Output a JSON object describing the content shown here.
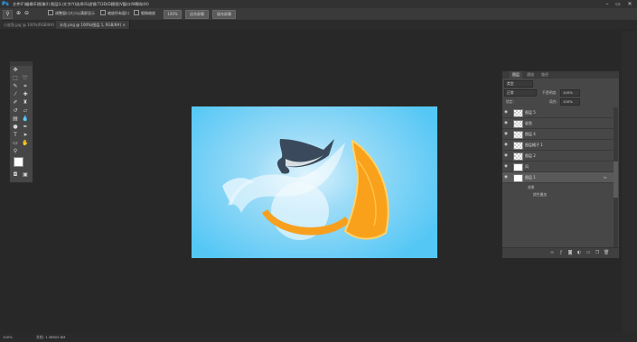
{
  "app": {
    "logo": "Ps"
  },
  "menu": [
    "文件(F)",
    "编辑(E)",
    "图像(I)",
    "图层(L)",
    "文字(Y)",
    "选择(S)",
    "滤镜(T)",
    "3D(D)",
    "视图(V)",
    "窗口(W)",
    "帮助(H)"
  ],
  "window_controls": [
    "–",
    "▭",
    "✕"
  ],
  "options": {
    "resize_windows": "调整窗口大小以满屏显示",
    "zoom_all": "缩放所有窗口",
    "scrubby_zoom": "细微缩放",
    "btn_100": "100%",
    "btn_fit": "适合屏幕",
    "btn_fill": "填充屏幕"
  },
  "tabs": [
    {
      "label": "小鲨鱼.jpg @ 100%(RGB/8#) ×",
      "active": false
    },
    {
      "label": "水花.png @ 100%(图层 1, RGB/8#) ×",
      "active": true
    }
  ],
  "layers_panel": {
    "tabs": [
      "图层",
      "通道",
      "路径"
    ],
    "kind_filter": "类型",
    "blend_mode": "正常",
    "opacity_label": "不透明度:",
    "opacity_value": "100%",
    "lock_label": "锁定:",
    "fill_label": "填充:",
    "fill_value": "100%",
    "layers": [
      {
        "name": "图层 5",
        "thumb": "checker",
        "selected": false
      },
      {
        "name": "鲨鱼",
        "thumb": "checker",
        "selected": false
      },
      {
        "name": "图层 4",
        "thumb": "checker",
        "selected": false
      },
      {
        "name": "图层橘子 1",
        "thumb": "checker",
        "selected": false
      },
      {
        "name": "图层 2",
        "thumb": "checker",
        "selected": false
      },
      {
        "name": "风",
        "thumb": "white",
        "selected": false
      },
      {
        "name": "图层 1",
        "thumb": "white",
        "selected": true
      }
    ],
    "effects_label": "效果",
    "effect_item": "颜色叠加",
    "fx": "fx"
  },
  "status": {
    "zoom": "100%",
    "doc": "文档: 1.38M/5.8M"
  }
}
